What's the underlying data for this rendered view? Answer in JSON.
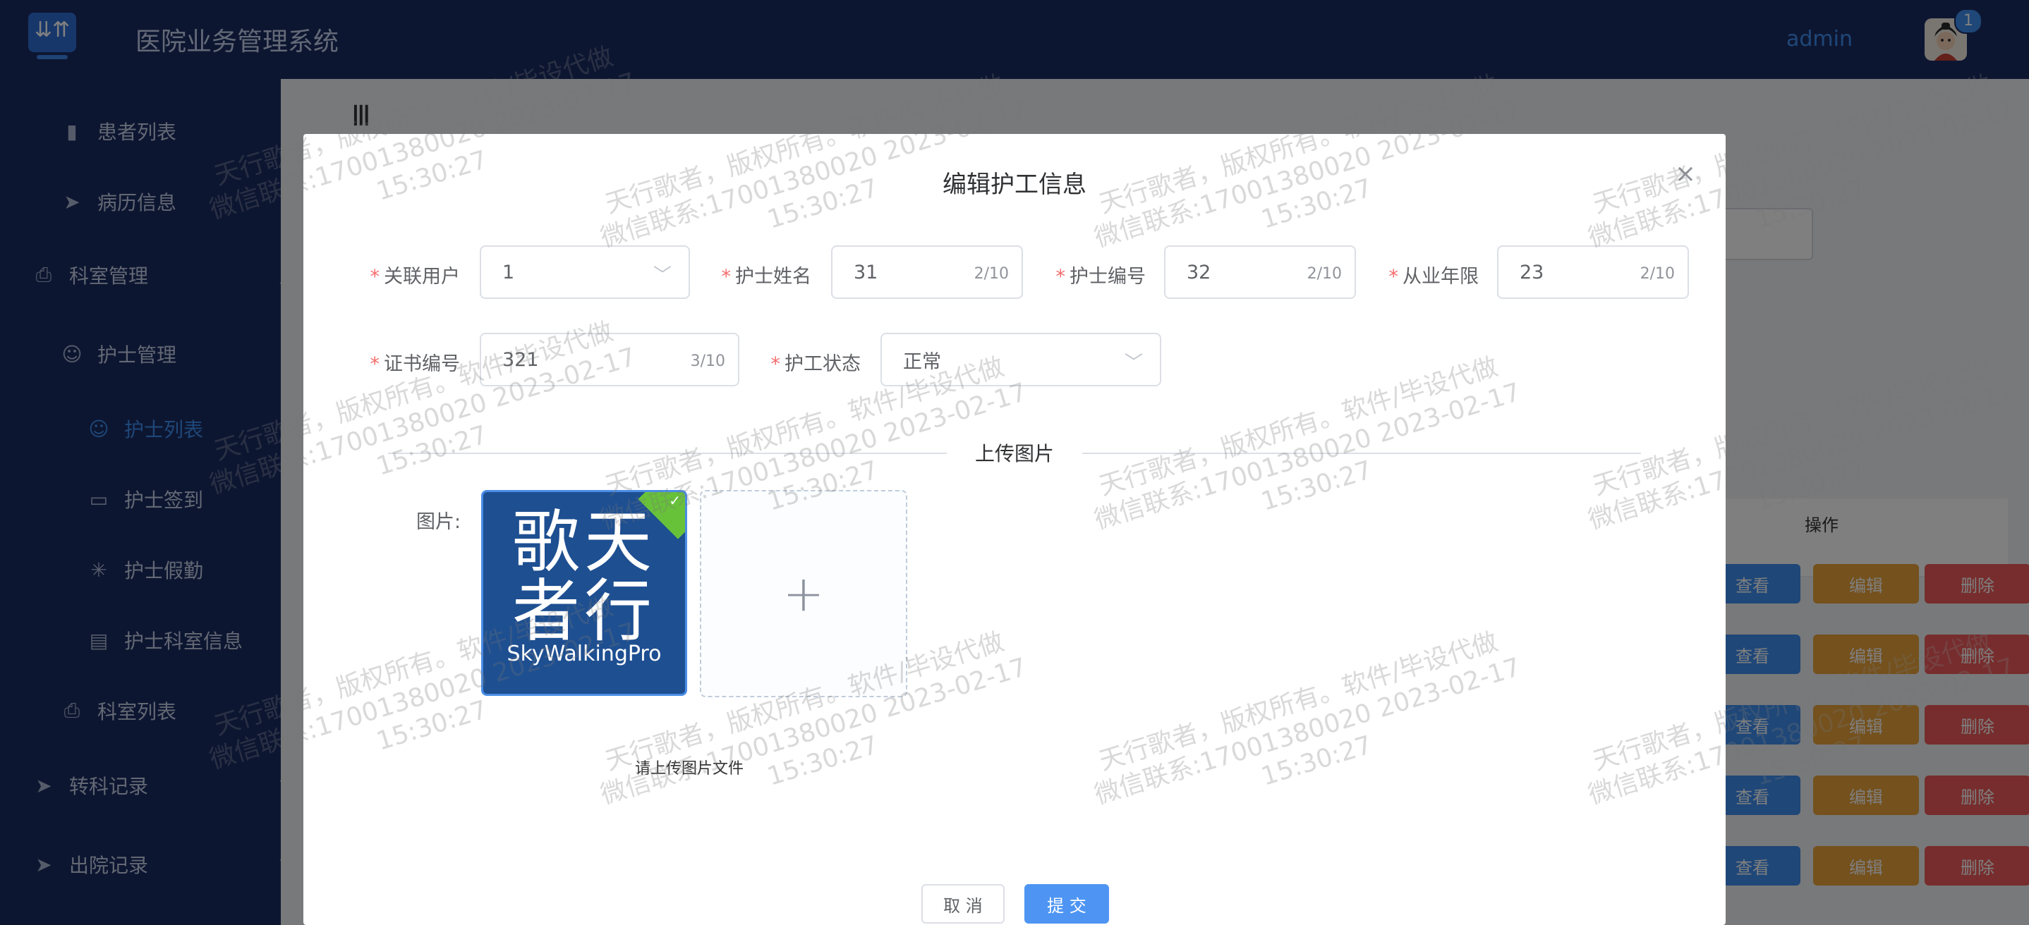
{
  "header": {
    "title": "医院业务管理系统",
    "user": "admin",
    "notification_count": "1"
  },
  "sidebar": {
    "items": [
      {
        "label": "患者列表",
        "icon": "bar-chart-icon"
      },
      {
        "label": "病历信息",
        "icon": "paper-plane-icon"
      },
      {
        "label": "科室管理",
        "icon": "printer-icon"
      },
      {
        "label": "护士管理",
        "icon": "user-icon"
      },
      {
        "label": "护士列表",
        "icon": "user-icon"
      },
      {
        "label": "护士签到",
        "icon": "chat-icon"
      },
      {
        "label": "护士假勤",
        "icon": "loading-icon"
      },
      {
        "label": "护士科室信息",
        "icon": "list-icon"
      },
      {
        "label": "科室列表",
        "icon": "printer-icon"
      },
      {
        "label": "转科记录",
        "icon": "paper-plane-icon"
      },
      {
        "label": "出院记录",
        "icon": "paper-plane-icon"
      }
    ]
  },
  "background": {
    "op_header": "操作",
    "view": "查看",
    "edit": "编辑",
    "delete": "删除"
  },
  "dialog": {
    "title": "编辑护工信息",
    "fields": {
      "user": {
        "label": "关联用户",
        "value": "1"
      },
      "name": {
        "label": "护士姓名",
        "value": "31",
        "count": "2/10"
      },
      "number": {
        "label": "护士编号",
        "value": "32",
        "count": "2/10"
      },
      "years": {
        "label": "从业年限",
        "value": "23",
        "count": "2/10"
      },
      "cert": {
        "label": "证书编号",
        "value": "321",
        "count": "3/10"
      },
      "status": {
        "label": "护工状态",
        "value": "正常"
      }
    },
    "section": "上传图片",
    "image_label": "图片:",
    "thumb_text_big": "歌天\n者行",
    "thumb_text_small": "SkyWalkingPro",
    "tip": "请上传图片文件",
    "cancel": "取 消",
    "submit": "提 交"
  },
  "watermark": {
    "line1": "天行歌者，版权所有。软件/毕设代做",
    "line2": "微信联系:17001380020 2023-02-17",
    "line3": "15:30:27"
  }
}
